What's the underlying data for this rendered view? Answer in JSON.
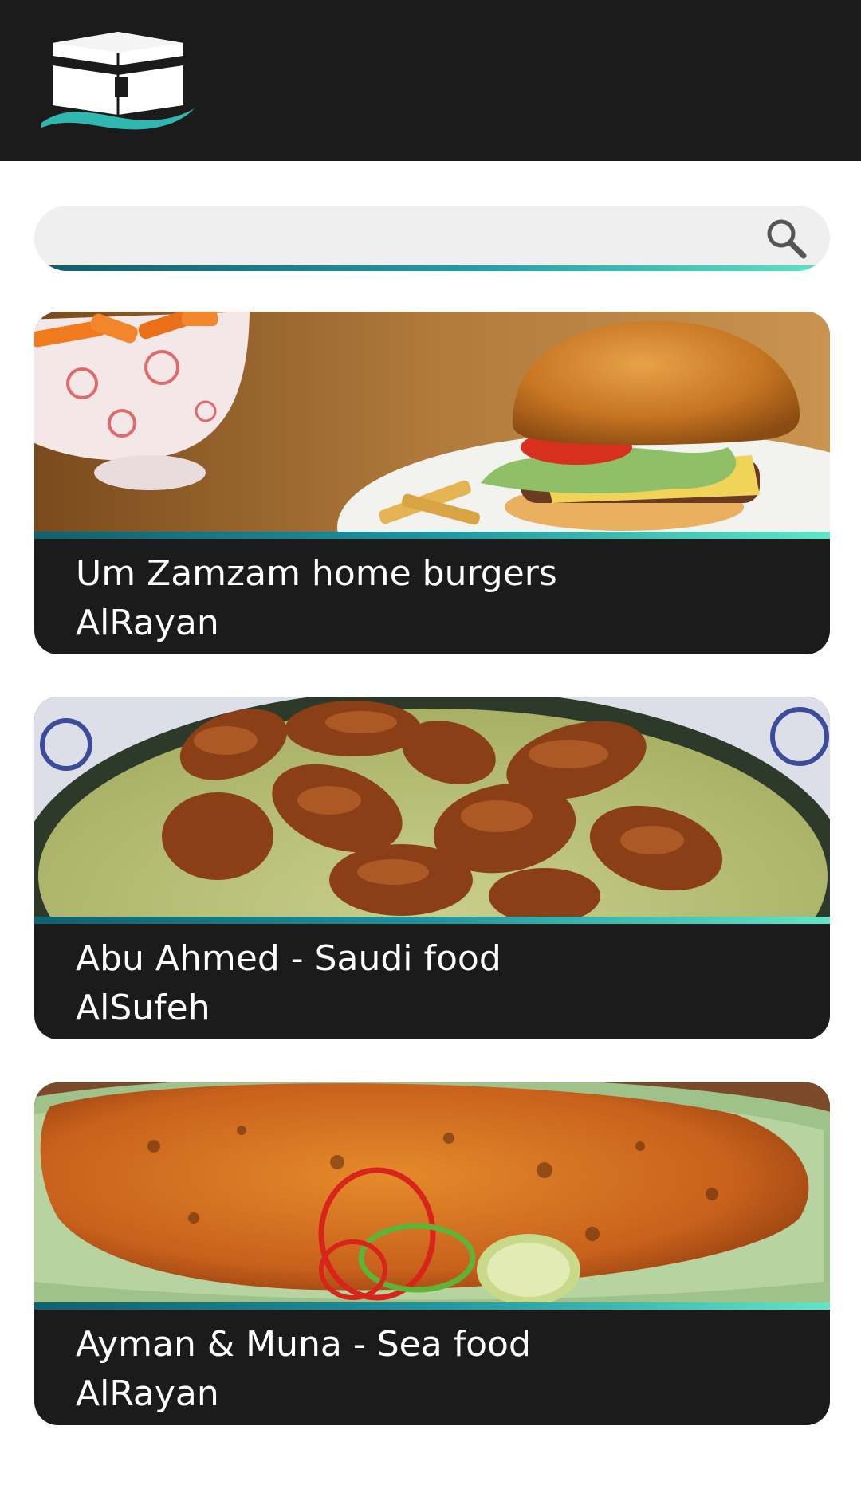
{
  "header": {
    "logo_icon": "kaaba-logo-icon",
    "background": "#1b1b1b"
  },
  "search": {
    "value": "",
    "placeholder": "",
    "icon": "search-icon"
  },
  "listings": [
    {
      "name": "Um Zamzam home burgers",
      "location": "AlRayan",
      "image": "burger-photo"
    },
    {
      "name": "Abu Ahmed - Saudi food",
      "location": "AlSufeh",
      "image": "chicken-rice-photo"
    },
    {
      "name": "Ayman & Muna - Sea food",
      "location": "AlRayan",
      "image": "grilled-fish-photo"
    }
  ],
  "colors": {
    "accent_start": "#0f6170",
    "accent_end": "#5fe6c6",
    "card_bg": "#1b1b1b",
    "search_bg": "#efefef"
  }
}
